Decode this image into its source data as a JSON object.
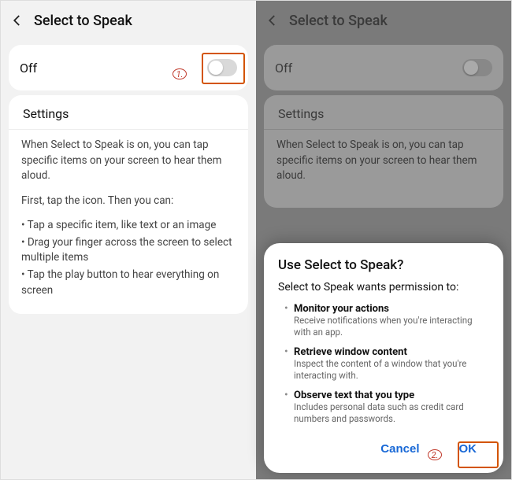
{
  "left": {
    "header_title": "Select to Speak",
    "toggle_label": "Off",
    "settings_heading": "Settings",
    "desc_p1": "When Select to Speak is on, you can tap specific items on your screen to hear them aloud.",
    "desc_p2": "First, tap the icon. Then you can:",
    "bullets": [
      "• Tap a specific item, like text or an image",
      "• Drag your finger across the screen to select multiple items",
      "• Tap the play button to hear everything on screen"
    ],
    "annotation1": "1."
  },
  "right": {
    "header_title": "Select to Speak",
    "toggle_label": "Off",
    "settings_heading": "Settings",
    "desc_p1": "When Select to Speak is on, you can tap specific items on your screen to hear them aloud.",
    "dialog": {
      "title": "Use Select to Speak?",
      "subtitle": "Select to Speak wants permission to:",
      "perms": [
        {
          "title": "Monitor your actions",
          "desc": "Receive notifications when you're interacting with an app."
        },
        {
          "title": "Retrieve window content",
          "desc": "Inspect the content of a window that you're interacting with."
        },
        {
          "title": "Observe text that you type",
          "desc": "Includes personal data such as credit card numbers and passwords."
        }
      ],
      "cancel": "Cancel",
      "ok": "OK"
    },
    "annotation2": "2."
  }
}
